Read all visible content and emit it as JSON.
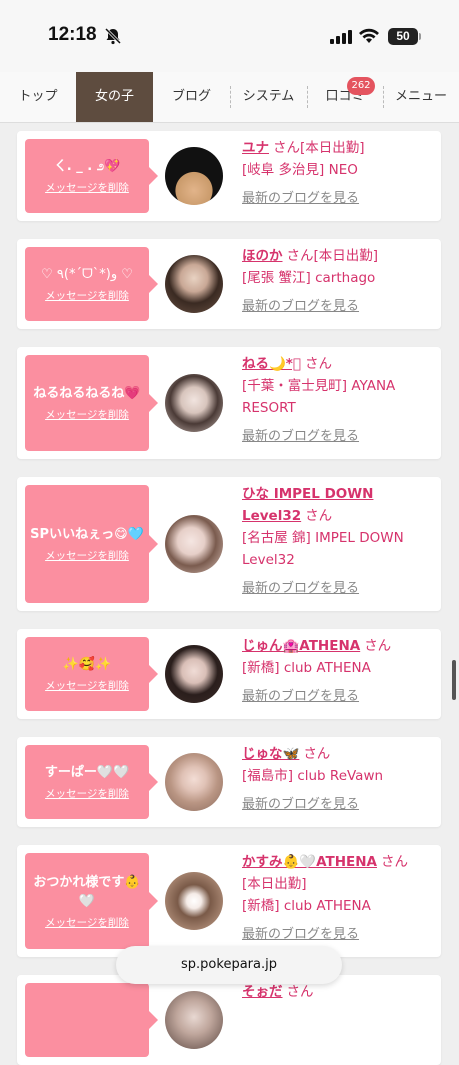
{
  "status": {
    "time": "12:18",
    "battery": "50"
  },
  "tabs": [
    {
      "label": "トップ",
      "active": false
    },
    {
      "label": "女の子",
      "active": true
    },
    {
      "label": "ブログ",
      "active": false
    },
    {
      "label": "システム",
      "active": false
    },
    {
      "label": "口コミ",
      "active": false,
      "badge": "262"
    },
    {
      "label": "メニュー",
      "active": false
    }
  ],
  "delete_label": "メッセージを削除",
  "san": "さん",
  "blog_label": "最新のブログを見る",
  "cards": [
    {
      "message": "ㄑ. _ . ೨💖",
      "name": "ユナ",
      "today": "[本日出勤]",
      "location": "[岐阜 多治見] NEO"
    },
    {
      "message": "♡ ٩(*ˊᗜˋ*)و ♡",
      "name": "ほのか",
      "today": "[本日出勤]",
      "location": "[尾張 蟹江] carthago"
    },
    {
      "message": "ねるねるねるね💗",
      "name": "ねる🌙*ﾟ",
      "today": "",
      "location": "[千葉・富士見町] AYANA RESORT"
    },
    {
      "message": "SPいいねぇっ😋🩵",
      "name": "ひな IMPEL DOWN Level32",
      "today": "",
      "location": "[名古屋 錦] IMPEL DOWN Level32"
    },
    {
      "message": "✨🥰✨",
      "name": "じゅん🏩ATHENA",
      "today": "",
      "location": "[新橋] club ATHENA"
    },
    {
      "message": "すーぱー🤍🤍",
      "name": "じゅな🦋",
      "today": "",
      "location": "[福島市] club ReVawn"
    },
    {
      "message": "おつかれ様です👶🤍",
      "name": "かすみ👶🤍ATHENA",
      "today": "[本日出勤]",
      "location": "[新橋] club ATHENA"
    },
    {
      "message": "",
      "name": "そぉだ",
      "today": "",
      "location": ""
    }
  ],
  "url_bar": "sp.pokepara.jp"
}
